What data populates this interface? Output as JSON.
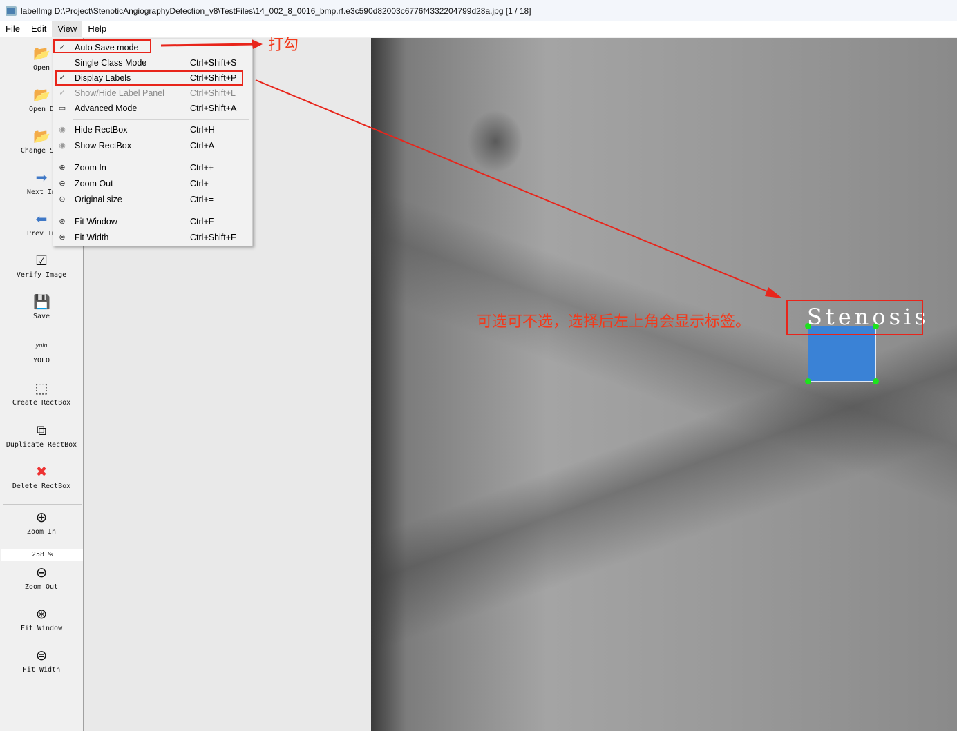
{
  "window": {
    "title": "labelImg D:\\Project\\StenoticAngiographyDetection_v8\\TestFiles\\14_002_8_0016_bmp.rf.e3c590d82003c6776f4332204799d28a.jpg [1 / 18]"
  },
  "menubar": [
    "File",
    "Edit",
    "View",
    "Help"
  ],
  "toolbar": {
    "open": "Open",
    "open_dir": "Open D",
    "change_save": "Change Sav",
    "next": "Next Im",
    "prev": "Prev Im",
    "verify": "Verify Image",
    "save": "Save",
    "yolo_icon": "yolo",
    "yolo": "YOLO",
    "create": "Create RectBox",
    "duplicate": "Duplicate RectBox",
    "delete": "Delete RectBox",
    "zoom_in": "Zoom In",
    "zoom_value": "258 %",
    "zoom_out": "Zoom Out",
    "fit_window": "Fit Window",
    "fit_width": "Fit Width"
  },
  "view_menu": [
    {
      "label": "Auto Save mode",
      "shortcut": "",
      "checked": true
    },
    {
      "label": "Single Class Mode",
      "shortcut": "Ctrl+Shift+S",
      "checked": false
    },
    {
      "label": "Display Labels",
      "shortcut": "Ctrl+Shift+P",
      "checked": true
    },
    {
      "label": "Show/Hide Label Panel",
      "shortcut": "Ctrl+Shift+L",
      "checked": true,
      "disabled": true
    },
    {
      "label": "Advanced Mode",
      "shortcut": "Ctrl+Shift+A"
    },
    {
      "label": "Hide RectBox",
      "shortcut": "Ctrl+H"
    },
    {
      "label": "Show RectBox",
      "shortcut": "Ctrl+A"
    },
    {
      "label": "Zoom In",
      "shortcut": "Ctrl++"
    },
    {
      "label": "Zoom Out",
      "shortcut": "Ctrl+-"
    },
    {
      "label": "Original size",
      "shortcut": "Ctrl+="
    },
    {
      "label": "Fit Window",
      "shortcut": "Ctrl+F"
    },
    {
      "label": "Fit Width",
      "shortcut": "Ctrl+Shift+F"
    }
  ],
  "canvas": {
    "box_label": "Stenosis",
    "box_color": "#3a82d6"
  },
  "annotations": {
    "check_note": "打勾",
    "display_note": "可选可不选，选择后左上角会显示标签。",
    "color": "#e8251b"
  }
}
